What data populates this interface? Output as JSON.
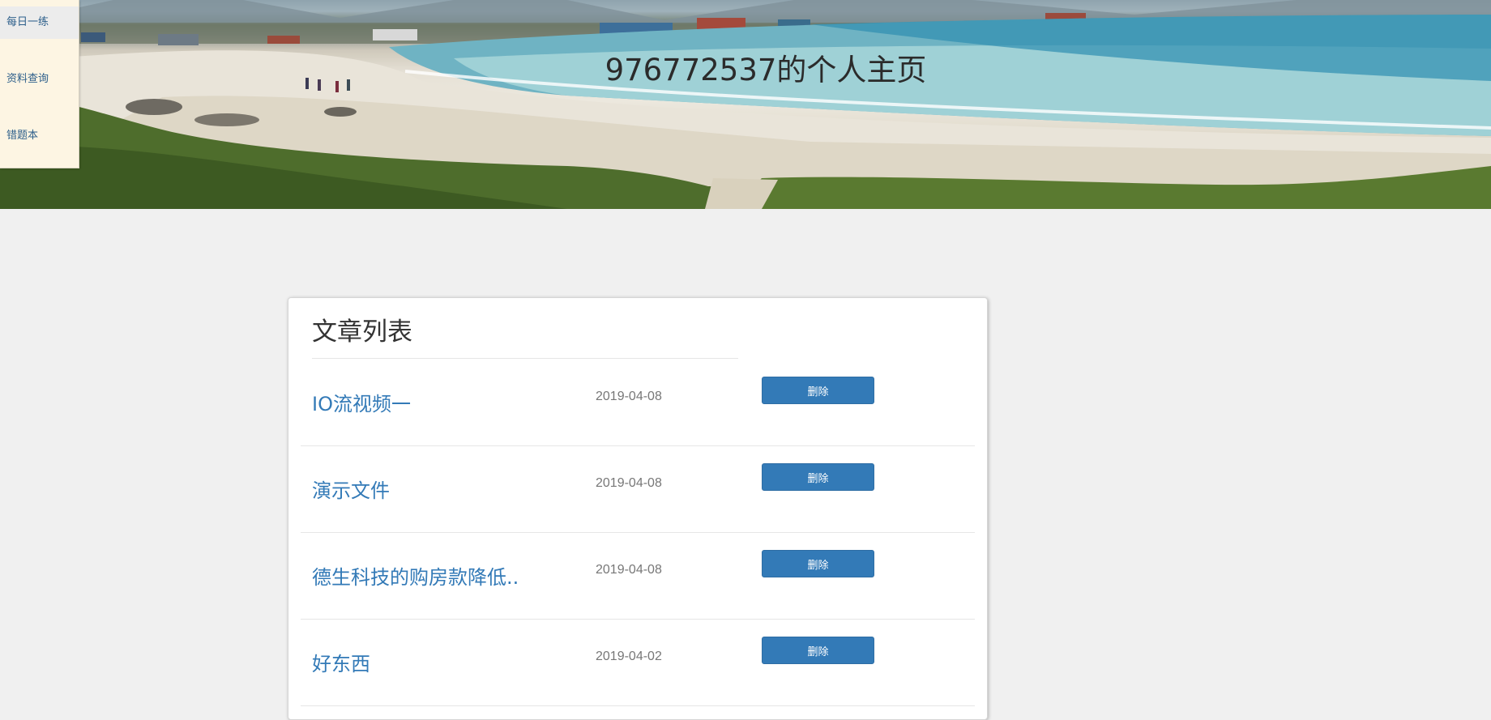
{
  "banner": {
    "title": "976772537的个人主页"
  },
  "sidebar": {
    "items": [
      {
        "label": "每日一练",
        "active": true
      },
      {
        "label": "资料查询",
        "active": false
      },
      {
        "label": "错题本",
        "active": false
      }
    ]
  },
  "article_list": {
    "title": "文章列表",
    "delete_label": "删除",
    "rows": [
      {
        "title": "IO流视频一",
        "date": "2019-04-08"
      },
      {
        "title": "演示文件",
        "date": "2019-04-08"
      },
      {
        "title": "德生科技的购房款降低..",
        "date": "2019-04-08"
      },
      {
        "title": "好东西",
        "date": "2019-04-02"
      }
    ]
  },
  "colors": {
    "link": "#337ab7",
    "button": "#337ab7",
    "page_background": "#f0f0f0",
    "sidebar_background": "#fdf5e3"
  }
}
